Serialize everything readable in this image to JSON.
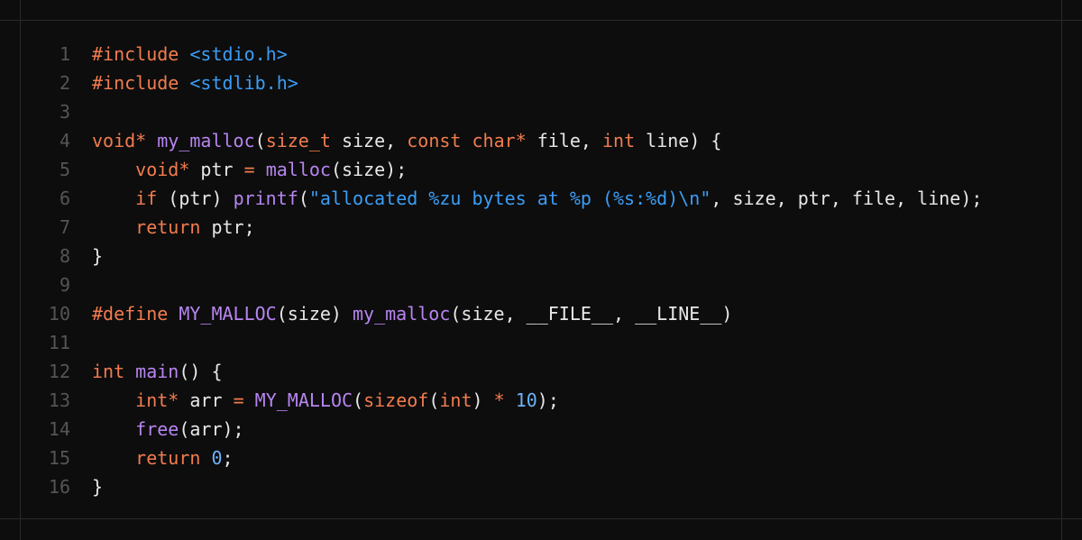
{
  "colors": {
    "background": "#0d0d0d",
    "keyword": "#f27c4f",
    "string": "#3b9df5",
    "function": "#b785f0",
    "number": "#6cb2f7",
    "plain": "#e8e8e8",
    "line_number": "#555555"
  },
  "lines": [
    {
      "n": "1",
      "tokens": [
        [
          "kw",
          "#include"
        ],
        [
          "pl",
          " "
        ],
        [
          "str",
          "<stdio.h>"
        ]
      ]
    },
    {
      "n": "2",
      "tokens": [
        [
          "kw",
          "#include"
        ],
        [
          "pl",
          " "
        ],
        [
          "str",
          "<stdlib.h>"
        ]
      ]
    },
    {
      "n": "3",
      "tokens": []
    },
    {
      "n": "4",
      "tokens": [
        [
          "kw",
          "void*"
        ],
        [
          "pl",
          " "
        ],
        [
          "fn",
          "my_malloc"
        ],
        [
          "pl",
          "("
        ],
        [
          "kw",
          "size_t"
        ],
        [
          "pl",
          " size, "
        ],
        [
          "kw",
          "const"
        ],
        [
          "pl",
          " "
        ],
        [
          "kw",
          "char*"
        ],
        [
          "pl",
          " file, "
        ],
        [
          "kw",
          "int"
        ],
        [
          "pl",
          " line) {"
        ]
      ]
    },
    {
      "n": "5",
      "tokens": [
        [
          "pl",
          "    "
        ],
        [
          "kw",
          "void*"
        ],
        [
          "pl",
          " ptr "
        ],
        [
          "kw",
          "="
        ],
        [
          "pl",
          " "
        ],
        [
          "fn",
          "malloc"
        ],
        [
          "pl",
          "(size);"
        ]
      ]
    },
    {
      "n": "6",
      "tokens": [
        [
          "pl",
          "    "
        ],
        [
          "kw",
          "if"
        ],
        [
          "pl",
          " (ptr) "
        ],
        [
          "fn",
          "printf"
        ],
        [
          "pl",
          "("
        ],
        [
          "str",
          "\"allocated %zu bytes at %p (%s:%d)\\n\""
        ],
        [
          "pl",
          ", size, ptr, file, line);"
        ]
      ]
    },
    {
      "n": "7",
      "tokens": [
        [
          "pl",
          "    "
        ],
        [
          "kw",
          "return"
        ],
        [
          "pl",
          " ptr;"
        ]
      ]
    },
    {
      "n": "8",
      "tokens": [
        [
          "pl",
          "}"
        ]
      ]
    },
    {
      "n": "9",
      "tokens": []
    },
    {
      "n": "10",
      "tokens": [
        [
          "kw",
          "#define"
        ],
        [
          "pl",
          " "
        ],
        [
          "fn",
          "MY_MALLOC"
        ],
        [
          "pl",
          "(size) "
        ],
        [
          "fn",
          "my_malloc"
        ],
        [
          "pl",
          "(size, __FILE__, __LINE__)"
        ]
      ]
    },
    {
      "n": "11",
      "tokens": []
    },
    {
      "n": "12",
      "tokens": [
        [
          "kw",
          "int"
        ],
        [
          "pl",
          " "
        ],
        [
          "fn",
          "main"
        ],
        [
          "pl",
          "() {"
        ]
      ]
    },
    {
      "n": "13",
      "tokens": [
        [
          "pl",
          "    "
        ],
        [
          "kw",
          "int*"
        ],
        [
          "pl",
          " arr "
        ],
        [
          "kw",
          "="
        ],
        [
          "pl",
          " "
        ],
        [
          "fn",
          "MY_MALLOC"
        ],
        [
          "pl",
          "("
        ],
        [
          "kw",
          "sizeof"
        ],
        [
          "pl",
          "("
        ],
        [
          "kw",
          "int"
        ],
        [
          "pl",
          ") "
        ],
        [
          "kw",
          "*"
        ],
        [
          "pl",
          " "
        ],
        [
          "num",
          "10"
        ],
        [
          "pl",
          ");"
        ]
      ]
    },
    {
      "n": "14",
      "tokens": [
        [
          "pl",
          "    "
        ],
        [
          "fn",
          "free"
        ],
        [
          "pl",
          "(arr);"
        ]
      ]
    },
    {
      "n": "15",
      "tokens": [
        [
          "pl",
          "    "
        ],
        [
          "kw",
          "return"
        ],
        [
          "pl",
          " "
        ],
        [
          "num",
          "0"
        ],
        [
          "pl",
          ";"
        ]
      ]
    },
    {
      "n": "16",
      "tokens": [
        [
          "pl",
          "}"
        ]
      ]
    }
  ]
}
